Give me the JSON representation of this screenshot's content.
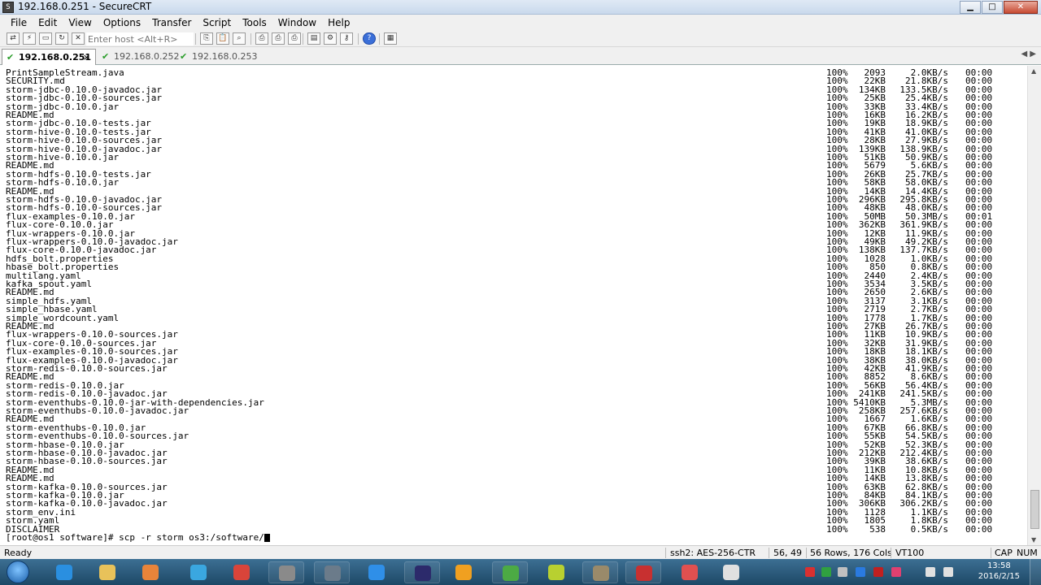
{
  "window": {
    "title": "192.168.0.251 - SecureCRT",
    "icon": "securecrt-app-icon",
    "icon_glyph": "S",
    "buttons": {
      "minimize": "▁",
      "maximize": "□",
      "close": "✕"
    }
  },
  "menu": [
    "File",
    "Edit",
    "View",
    "Options",
    "Transfer",
    "Script",
    "Tools",
    "Window",
    "Help"
  ],
  "toolbar": {
    "host_placeholder": "Enter host <Alt+R>",
    "buttons": [
      {
        "name": "connect-icon",
        "glyph": "⇄"
      },
      {
        "name": "quick-connect-icon",
        "glyph": "⚡"
      },
      {
        "name": "connect-in-tab-icon",
        "glyph": "▭"
      },
      {
        "name": "reconnect-icon",
        "glyph": "↻"
      },
      {
        "name": "disconnect-icon",
        "glyph": "✕"
      },
      {
        "name": "copy-icon",
        "glyph": "⎘"
      },
      {
        "name": "paste-icon",
        "glyph": "📋"
      },
      {
        "name": "find-icon",
        "glyph": "⌕"
      },
      {
        "name": "print-icon",
        "glyph": "⎙"
      },
      {
        "name": "print-selection-icon",
        "glyph": "⎙"
      },
      {
        "name": "print-setup-icon",
        "glyph": "⎙"
      },
      {
        "name": "sftp-icon",
        "glyph": "▤"
      },
      {
        "name": "options-icon",
        "glyph": "⚙"
      },
      {
        "name": "keymap-icon",
        "glyph": "⚷"
      },
      {
        "name": "help-icon",
        "glyph": "?"
      },
      {
        "name": "screen-icon",
        "glyph": "▦"
      }
    ]
  },
  "tabs": [
    {
      "label": "192.168.0.251",
      "active": true,
      "close": "×"
    },
    {
      "label": "192.168.0.252",
      "active": false
    },
    {
      "label": "192.168.0.253",
      "active": false
    }
  ],
  "tab_glyphs": {
    "check": "✔",
    "arrows": "◀ ▶"
  },
  "terminal": {
    "rows": [
      {
        "name": "PrintSampleStream.java",
        "pct": "100%",
        "size": "2093",
        "rate": "2.0KB/s",
        "time": "00:00"
      },
      {
        "name": "SECURITY.md",
        "pct": "100%",
        "size": "22KB",
        "rate": "21.8KB/s",
        "time": "00:00"
      },
      {
        "name": "storm-jdbc-0.10.0-javadoc.jar",
        "pct": "100%",
        "size": "134KB",
        "rate": "133.5KB/s",
        "time": "00:00"
      },
      {
        "name": "storm-jdbc-0.10.0-sources.jar",
        "pct": "100%",
        "size": "25KB",
        "rate": "25.4KB/s",
        "time": "00:00"
      },
      {
        "name": "storm-jdbc-0.10.0.jar",
        "pct": "100%",
        "size": "33KB",
        "rate": "33.4KB/s",
        "time": "00:00"
      },
      {
        "name": "README.md",
        "pct": "100%",
        "size": "16KB",
        "rate": "16.2KB/s",
        "time": "00:00"
      },
      {
        "name": "storm-jdbc-0.10.0-tests.jar",
        "pct": "100%",
        "size": "19KB",
        "rate": "18.9KB/s",
        "time": "00:00"
      },
      {
        "name": "storm-hive-0.10.0-tests.jar",
        "pct": "100%",
        "size": "41KB",
        "rate": "41.0KB/s",
        "time": "00:00"
      },
      {
        "name": "storm-hive-0.10.0-sources.jar",
        "pct": "100%",
        "size": "28KB",
        "rate": "27.9KB/s",
        "time": "00:00"
      },
      {
        "name": "storm-hive-0.10.0-javadoc.jar",
        "pct": "100%",
        "size": "139KB",
        "rate": "138.9KB/s",
        "time": "00:00"
      },
      {
        "name": "storm-hive-0.10.0.jar",
        "pct": "100%",
        "size": "51KB",
        "rate": "50.9KB/s",
        "time": "00:00"
      },
      {
        "name": "README.md",
        "pct": "100%",
        "size": "5679",
        "rate": "5.6KB/s",
        "time": "00:00"
      },
      {
        "name": "storm-hdfs-0.10.0-tests.jar",
        "pct": "100%",
        "size": "26KB",
        "rate": "25.7KB/s",
        "time": "00:00"
      },
      {
        "name": "storm-hdfs-0.10.0.jar",
        "pct": "100%",
        "size": "58KB",
        "rate": "58.0KB/s",
        "time": "00:00"
      },
      {
        "name": "README.md",
        "pct": "100%",
        "size": "14KB",
        "rate": "14.4KB/s",
        "time": "00:00"
      },
      {
        "name": "storm-hdfs-0.10.0-javadoc.jar",
        "pct": "100%",
        "size": "296KB",
        "rate": "295.8KB/s",
        "time": "00:00"
      },
      {
        "name": "storm-hdfs-0.10.0-sources.jar",
        "pct": "100%",
        "size": "48KB",
        "rate": "48.0KB/s",
        "time": "00:00"
      },
      {
        "name": "flux-examples-0.10.0.jar",
        "pct": "100%",
        "size": "50MB",
        "rate": "50.3MB/s",
        "time": "00:01"
      },
      {
        "name": "flux-core-0.10.0.jar",
        "pct": "100%",
        "size": "362KB",
        "rate": "361.9KB/s",
        "time": "00:00"
      },
      {
        "name": "flux-wrappers-0.10.0.jar",
        "pct": "100%",
        "size": "12KB",
        "rate": "11.9KB/s",
        "time": "00:00"
      },
      {
        "name": "flux-wrappers-0.10.0-javadoc.jar",
        "pct": "100%",
        "size": "49KB",
        "rate": "49.2KB/s",
        "time": "00:00"
      },
      {
        "name": "flux-core-0.10.0-javadoc.jar",
        "pct": "100%",
        "size": "138KB",
        "rate": "137.7KB/s",
        "time": "00:00"
      },
      {
        "name": "hdfs_bolt.properties",
        "pct": "100%",
        "size": "1028",
        "rate": "1.0KB/s",
        "time": "00:00"
      },
      {
        "name": "hbase_bolt.properties",
        "pct": "100%",
        "size": "850",
        "rate": "0.8KB/s",
        "time": "00:00"
      },
      {
        "name": "multilang.yaml",
        "pct": "100%",
        "size": "2440",
        "rate": "2.4KB/s",
        "time": "00:00"
      },
      {
        "name": "kafka_spout.yaml",
        "pct": "100%",
        "size": "3534",
        "rate": "3.5KB/s",
        "time": "00:00"
      },
      {
        "name": "README.md",
        "pct": "100%",
        "size": "2650",
        "rate": "2.6KB/s",
        "time": "00:00"
      },
      {
        "name": "simple_hdfs.yaml",
        "pct": "100%",
        "size": "3137",
        "rate": "3.1KB/s",
        "time": "00:00"
      },
      {
        "name": "simple_hbase.yaml",
        "pct": "100%",
        "size": "2719",
        "rate": "2.7KB/s",
        "time": "00:00"
      },
      {
        "name": "simple_wordcount.yaml",
        "pct": "100%",
        "size": "1778",
        "rate": "1.7KB/s",
        "time": "00:00"
      },
      {
        "name": "README.md",
        "pct": "100%",
        "size": "27KB",
        "rate": "26.7KB/s",
        "time": "00:00"
      },
      {
        "name": "flux-wrappers-0.10.0-sources.jar",
        "pct": "100%",
        "size": "11KB",
        "rate": "10.9KB/s",
        "time": "00:00"
      },
      {
        "name": "flux-core-0.10.0-sources.jar",
        "pct": "100%",
        "size": "32KB",
        "rate": "31.9KB/s",
        "time": "00:00"
      },
      {
        "name": "flux-examples-0.10.0-sources.jar",
        "pct": "100%",
        "size": "18KB",
        "rate": "18.1KB/s",
        "time": "00:00"
      },
      {
        "name": "flux-examples-0.10.0-javadoc.jar",
        "pct": "100%",
        "size": "38KB",
        "rate": "38.0KB/s",
        "time": "00:00"
      },
      {
        "name": "storm-redis-0.10.0-sources.jar",
        "pct": "100%",
        "size": "42KB",
        "rate": "41.9KB/s",
        "time": "00:00"
      },
      {
        "name": "README.md",
        "pct": "100%",
        "size": "8852",
        "rate": "8.6KB/s",
        "time": "00:00"
      },
      {
        "name": "storm-redis-0.10.0.jar",
        "pct": "100%",
        "size": "56KB",
        "rate": "56.4KB/s",
        "time": "00:00"
      },
      {
        "name": "storm-redis-0.10.0-javadoc.jar",
        "pct": "100%",
        "size": "241KB",
        "rate": "241.5KB/s",
        "time": "00:00"
      },
      {
        "name": "storm-eventhubs-0.10.0-jar-with-dependencies.jar",
        "pct": "100%",
        "size": "5410KB",
        "rate": "5.3MB/s",
        "time": "00:00"
      },
      {
        "name": "storm-eventhubs-0.10.0-javadoc.jar",
        "pct": "100%",
        "size": "258KB",
        "rate": "257.6KB/s",
        "time": "00:00"
      },
      {
        "name": "README.md",
        "pct": "100%",
        "size": "1667",
        "rate": "1.6KB/s",
        "time": "00:00"
      },
      {
        "name": "storm-eventhubs-0.10.0.jar",
        "pct": "100%",
        "size": "67KB",
        "rate": "66.8KB/s",
        "time": "00:00"
      },
      {
        "name": "storm-eventhubs-0.10.0-sources.jar",
        "pct": "100%",
        "size": "55KB",
        "rate": "54.5KB/s",
        "time": "00:00"
      },
      {
        "name": "storm-hbase-0.10.0.jar",
        "pct": "100%",
        "size": "52KB",
        "rate": "52.3KB/s",
        "time": "00:00"
      },
      {
        "name": "storm-hbase-0.10.0-javadoc.jar",
        "pct": "100%",
        "size": "212KB",
        "rate": "212.4KB/s",
        "time": "00:00"
      },
      {
        "name": "storm-hbase-0.10.0-sources.jar",
        "pct": "100%",
        "size": "39KB",
        "rate": "38.6KB/s",
        "time": "00:00"
      },
      {
        "name": "README.md",
        "pct": "100%",
        "size": "11KB",
        "rate": "10.8KB/s",
        "time": "00:00"
      },
      {
        "name": "README.md",
        "pct": "100%",
        "size": "14KB",
        "rate": "13.8KB/s",
        "time": "00:00"
      },
      {
        "name": "storm-kafka-0.10.0-sources.jar",
        "pct": "100%",
        "size": "63KB",
        "rate": "62.8KB/s",
        "time": "00:00"
      },
      {
        "name": "storm-kafka-0.10.0.jar",
        "pct": "100%",
        "size": "84KB",
        "rate": "84.1KB/s",
        "time": "00:00"
      },
      {
        "name": "storm-kafka-0.10.0-javadoc.jar",
        "pct": "100%",
        "size": "306KB",
        "rate": "306.2KB/s",
        "time": "00:00"
      },
      {
        "name": "storm_env.ini",
        "pct": "100%",
        "size": "1128",
        "rate": "1.1KB/s",
        "time": "00:00"
      },
      {
        "name": "storm.yaml",
        "pct": "100%",
        "size": "1805",
        "rate": "1.8KB/s",
        "time": "00:00"
      },
      {
        "name": "DISCLAIMER",
        "pct": "100%",
        "size": "538",
        "rate": "0.5KB/s",
        "time": "00:00"
      }
    ],
    "prompt": "[root@os1 software]# scp -r storm os3:/software/"
  },
  "status": {
    "ready": "Ready",
    "cipher": "ssh2: AES-256-CTR",
    "cursor_pos": "56,  49",
    "dimensions": "56 Rows, 176 Cols",
    "emulation": "VT100",
    "caps": "CAP",
    "num": "NUM"
  },
  "taskbar": {
    "time": "13:58",
    "date": "2016/2/15",
    "apps": [
      {
        "name": "internet-explorer-icon",
        "color": "#2a8fe0"
      },
      {
        "name": "file-explorer-icon",
        "color": "#e8c25a"
      },
      {
        "name": "media-player-icon",
        "color": "#e8843a"
      },
      {
        "name": "network-icon",
        "color": "#3aa7e0"
      },
      {
        "name": "chrome-icon",
        "color": "#d9443a"
      },
      {
        "name": "ftp-client-icon",
        "color": "#8a8a8a"
      },
      {
        "name": "remote-desktop-icon",
        "color": "#6b7b8a"
      },
      {
        "name": "notes-icon",
        "color": "#2f8fe8"
      },
      {
        "name": "eclipse-icon",
        "color": "#2c2a6b"
      },
      {
        "name": "virtualbox-icon",
        "color": "#f0a020"
      },
      {
        "name": "securecrt-icon",
        "color": "#4caa44"
      },
      {
        "name": "mindmap-icon",
        "color": "#b8d030"
      },
      {
        "name": "ftp-transfer-icon",
        "color": "#9a8a6a"
      },
      {
        "name": "pdf-icon",
        "color": "#c83030"
      },
      {
        "name": "pencil-tool-icon",
        "color": "#e05050"
      },
      {
        "name": "sogou-icon",
        "color": "#e0e0e0"
      }
    ],
    "tray": [
      {
        "name": "tray-app-red-icon",
        "color": "#d93030"
      },
      {
        "name": "tray-app-green-icon",
        "color": "#30a040"
      },
      {
        "name": "tray-app-gray-icon",
        "color": "#c0c0c0"
      },
      {
        "name": "tray-bluetooth-icon",
        "color": "#2a7ae0"
      },
      {
        "name": "tray-security-icon",
        "color": "#c02020"
      },
      {
        "name": "tray-app-pink-icon",
        "color": "#e04070"
      },
      {
        "name": "tray-network-icon",
        "color": "#e0e0e0"
      },
      {
        "name": "tray-volume-icon",
        "color": "#e0e0e0"
      }
    ]
  }
}
